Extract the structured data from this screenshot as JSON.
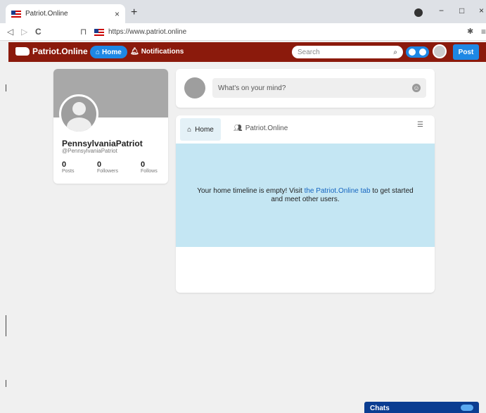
{
  "browser": {
    "tab_title": "Patriot.Online",
    "tab_close": "×",
    "new_tab": "+",
    "url": "https://www.patriot.online",
    "back": "◁",
    "forward": "▷",
    "reload": "C",
    "bookmark": "⊓",
    "win_min": "−",
    "win_max": "□",
    "win_close": "×"
  },
  "navbar": {
    "brand": "Patriot.Online",
    "home": "Home",
    "notifications": "Notifications",
    "search_placeholder": "Search",
    "post": "Post",
    "accent_color": "#8b1a0c",
    "button_color": "#1e88e5"
  },
  "profile": {
    "name": "PennsylvaniaPatriot",
    "handle": "@PennsylvaniaPatriot",
    "stats": [
      {
        "value": "0",
        "label": "Posts"
      },
      {
        "value": "0",
        "label": "Followers"
      },
      {
        "value": "0",
        "label": "Follows"
      }
    ]
  },
  "composer": {
    "placeholder": "What's on your mind?"
  },
  "timeline": {
    "tabs": [
      {
        "label": "Home",
        "icon": "home-icon"
      },
      {
        "label": "Patriot.Online",
        "icon": "users-icon"
      }
    ],
    "empty_before": "Your home timeline is empty! Visit ",
    "empty_link": "the Patriot.Online tab",
    "empty_after": " to get started and meet other users.",
    "empty_bg": "#c4e6f3"
  },
  "chats": {
    "label": "Chats"
  }
}
